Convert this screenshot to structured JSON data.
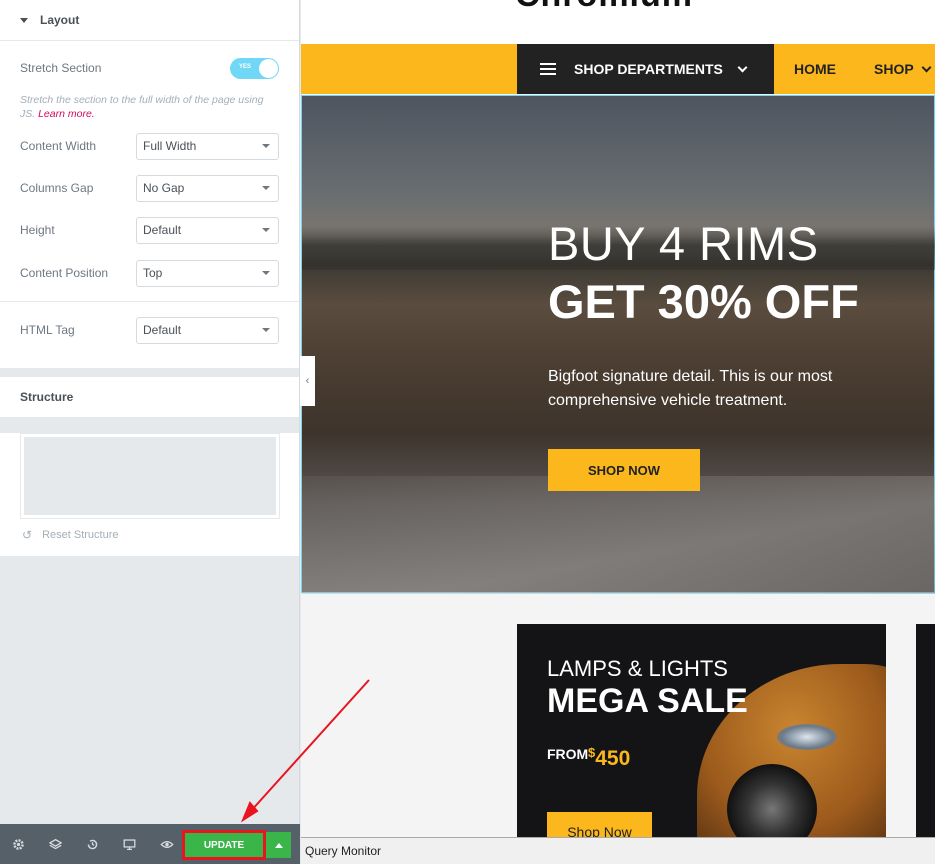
{
  "panel": {
    "layout": {
      "title": "Layout",
      "stretch_label": "Stretch Section",
      "stretch_toggle": "YES",
      "stretch_desc": "Stretch the section to the full width of the page using JS.",
      "learn_more": "Learn more.",
      "content_width_label": "Content Width",
      "content_width_value": "Full Width",
      "columns_gap_label": "Columns Gap",
      "columns_gap_value": "No Gap",
      "height_label": "Height",
      "height_value": "Default",
      "content_position_label": "Content Position",
      "content_position_value": "Top",
      "html_tag_label": "HTML Tag",
      "html_tag_value": "Default"
    },
    "structure": {
      "title": "Structure",
      "reset_label": "Reset Structure"
    },
    "footer": {
      "update_label": "UPDATE"
    }
  },
  "preview": {
    "nav": {
      "departments": "SHOP DEPARTMENTS",
      "home": "HOME",
      "shop": "SHOP"
    },
    "hero": {
      "line1": "BUY 4 RIMS",
      "line2": "GET 30% OFF",
      "text": "Bigfoot signature detail. This is our most comprehensive vehicle treatment.",
      "button": "SHOP NOW"
    },
    "promo": {
      "line1": "LAMPS & LIGHTS",
      "line2": "MEGA SALE",
      "from": "FROM",
      "currency": "$",
      "price": "450",
      "button": "Shop Now"
    }
  },
  "query_monitor": "Query Monitor",
  "colors": {
    "accent": "#fbb71c",
    "update_green": "#39b54a",
    "annotation_red": "#e8141f",
    "toggle_blue": "#71d7f7"
  }
}
